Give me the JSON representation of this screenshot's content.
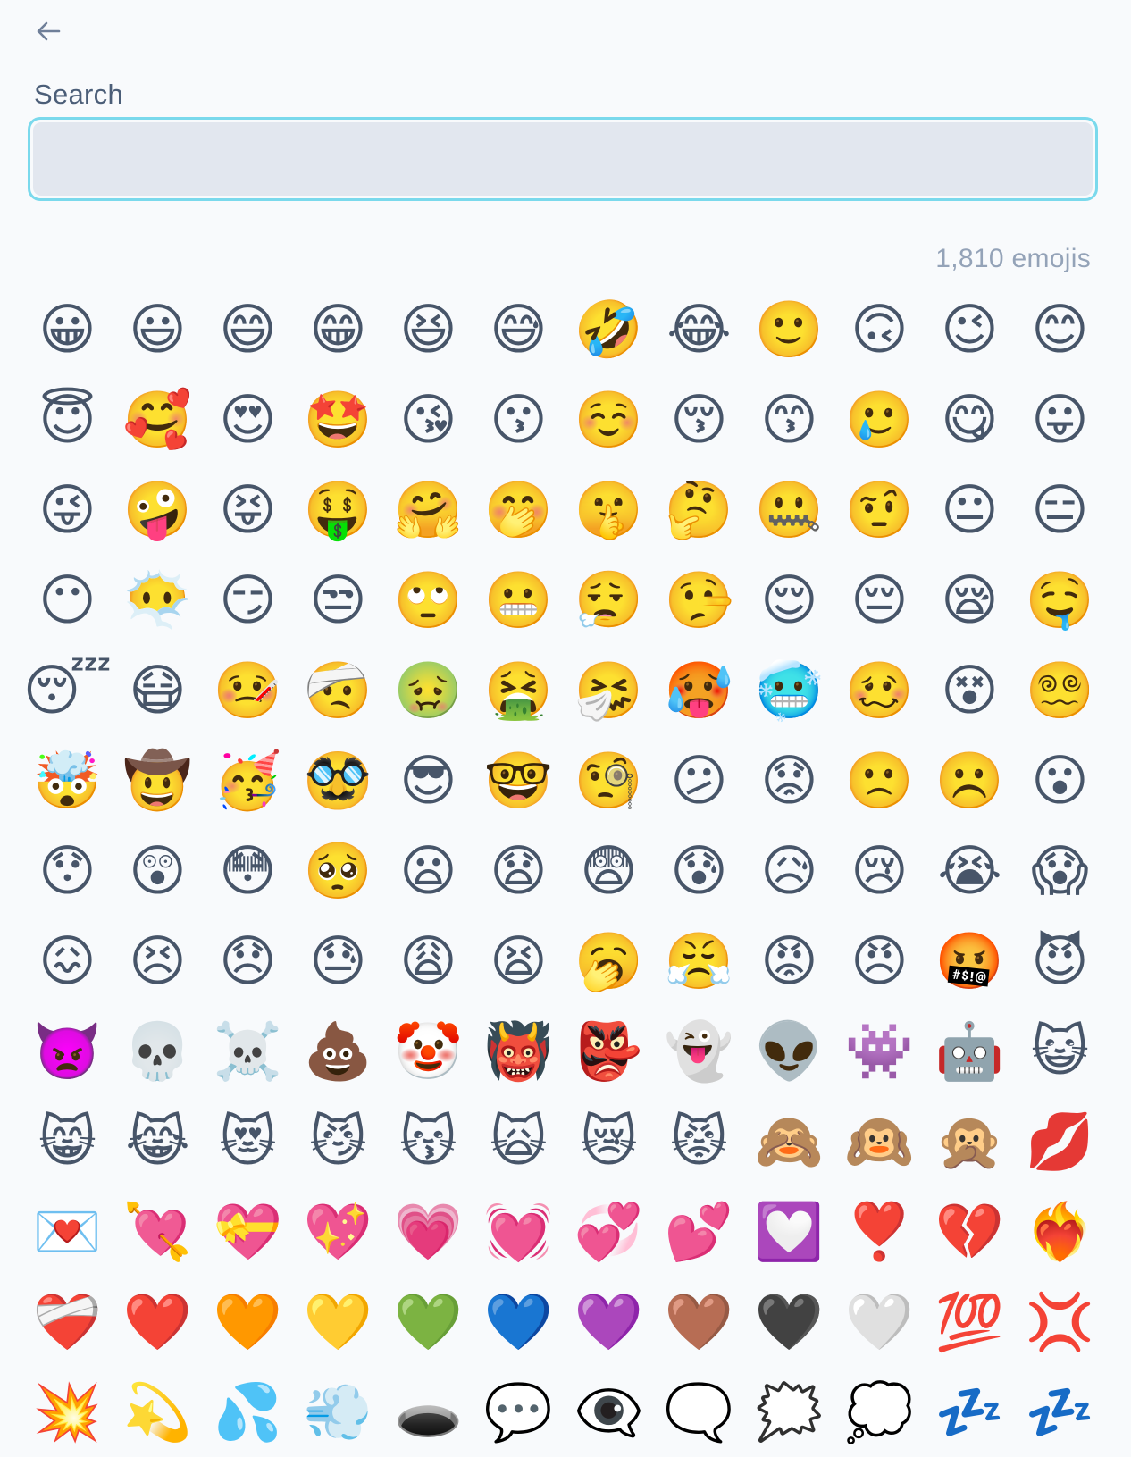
{
  "header": {
    "back_icon": "arrow-left-icon"
  },
  "search": {
    "label": "Search",
    "value": "",
    "placeholder": ""
  },
  "count_label": "1,810 emojis",
  "colors": {
    "background": "#f8fafc",
    "input_fill": "#e2e7ef",
    "focus_ring": "#7ad9ec",
    "label_text": "#4b5e78",
    "muted_text": "#94a3b8"
  },
  "emojis": [
    "😀",
    "😃",
    "😄",
    "😁",
    "😆",
    "😅",
    "🤣",
    "😂",
    "🙂",
    "🙃",
    "😉",
    "😊",
    "😇",
    "🥰",
    "😍",
    "🤩",
    "😘",
    "😗",
    "☺️",
    "😚",
    "😙",
    "🥲",
    "😋",
    "😛",
    "😜",
    "🤪",
    "😝",
    "🤑",
    "🤗",
    "🤭",
    "🤫",
    "🤔",
    "🤐",
    "🤨",
    "😐",
    "😑",
    "😶",
    "😶‍🌫️",
    "😏",
    "😒",
    "🙄",
    "😬",
    "😮‍💨",
    "🤥",
    "😌",
    "😔",
    "😪",
    "🤤",
    "😴",
    "😷",
    "🤒",
    "🤕",
    "🤢",
    "🤮",
    "🤧",
    "🥵",
    "🥶",
    "🥴",
    "😵",
    "😵‍💫",
    "🤯",
    "🤠",
    "🥳",
    "🥸",
    "😎",
    "🤓",
    "🧐",
    "😕",
    "😟",
    "🙁",
    "☹️",
    "😮",
    "😯",
    "😲",
    "😳",
    "🥺",
    "😦",
    "😧",
    "😨",
    "😰",
    "😥",
    "😢",
    "😭",
    "😱",
    "😖",
    "😣",
    "😞",
    "😓",
    "😩",
    "😫",
    "🥱",
    "😤",
    "😡",
    "😠",
    "🤬",
    "😈",
    "👿",
    "💀",
    "☠️",
    "💩",
    "🤡",
    "👹",
    "👺",
    "👻",
    "👽",
    "👾",
    "🤖",
    "😺",
    "😸",
    "😹",
    "😻",
    "😼",
    "😽",
    "🙀",
    "😿",
    "😾",
    "🙈",
    "🙉",
    "🙊",
    "💋",
    "💌",
    "💘",
    "💝",
    "💖",
    "💗",
    "💓",
    "💞",
    "💕",
    "💟",
    "❣️",
    "💔",
    "❤️‍🔥",
    "❤️‍🩹",
    "❤️",
    "🧡",
    "💛",
    "💚",
    "💙",
    "💜",
    "🤎",
    "🖤",
    "🤍",
    "💯",
    "💢",
    "💥",
    "💫",
    "💦",
    "💨",
    "🕳️",
    "💬",
    "👁️‍🗨️",
    "🗨️",
    "🗯️",
    "💭",
    "💤",
    "💤"
  ]
}
